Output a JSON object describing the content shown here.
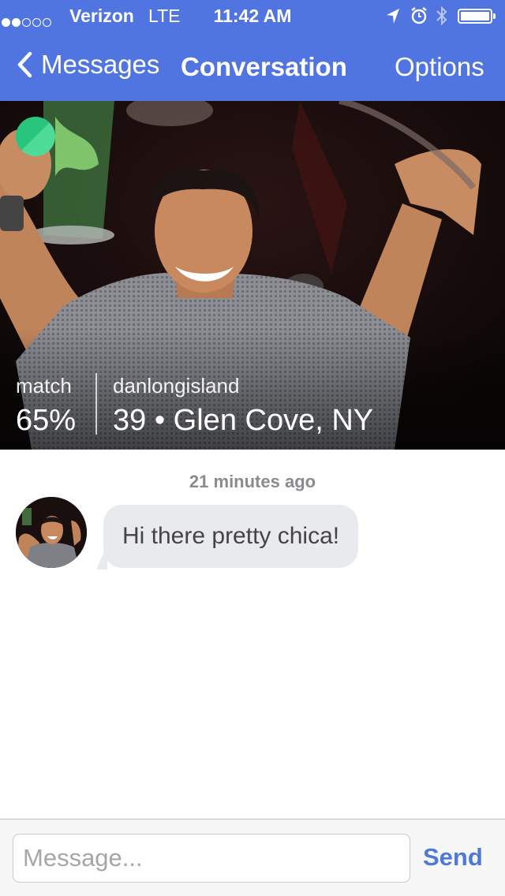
{
  "status_bar": {
    "signal_strength": 2,
    "signal_total": 5,
    "carrier": "Verizon",
    "network": "LTE",
    "time": "11:42 AM",
    "icons": [
      "location-arrow-icon",
      "alarm-icon",
      "bluetooth-icon"
    ],
    "battery_level": 1.0
  },
  "nav": {
    "back_label": "Messages",
    "title": "Conversation",
    "options_label": "Options"
  },
  "profile": {
    "online": true,
    "match_label": "match",
    "match_value": "65%",
    "username": "danlongisland",
    "age_location": "39 • Glen Cove, NY"
  },
  "conversation": {
    "timestamp": "21 minutes ago",
    "messages": [
      {
        "from": "them",
        "text": "Hi there pretty chica!"
      }
    ]
  },
  "composer": {
    "placeholder": "Message...",
    "send_label": "Send"
  },
  "colors": {
    "nav_background": "#5175e0",
    "online_indicator": "#29c47e",
    "bubble_background": "#e9eaee",
    "send_text": "#4e79d8"
  }
}
